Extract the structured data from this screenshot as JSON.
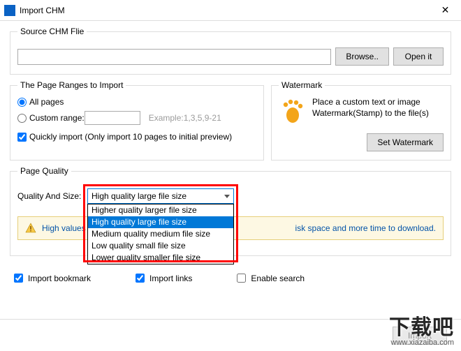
{
  "window": {
    "title": "Import CHM",
    "close": "✕"
  },
  "source": {
    "legend": "Source CHM Flie",
    "value": "",
    "browse": "Browse..",
    "open": "Open it"
  },
  "ranges": {
    "legend": "The Page Ranges to Import",
    "all_label": "All pages",
    "custom_label": "Custom range:",
    "custom_value": "",
    "example": "Example:1,3,5,9-21",
    "quick_label": "Quickly import (Only import 10 pages to  initial  preview)"
  },
  "watermark": {
    "legend": "Watermark",
    "text": "Place a custom text or image Watermark(Stamp) to the file(s)",
    "set_btn": "Set Watermark"
  },
  "quality": {
    "legend": "Page Quality",
    "label": "Quality And Size:",
    "selected": "High quality large file size",
    "options": [
      "Higher quality larger file size",
      "High quality large file size",
      "Medium quality medium file size",
      "Low quality small file size",
      "Lower quality smaller file size"
    ],
    "notice_pre": "High values p",
    "notice_post": "isk space and more time to download."
  },
  "checks": {
    "bookmark": "Import bookmark",
    "links": "Import links",
    "search": "Enable search"
  },
  "footer": {
    "import": "Import"
  },
  "overlay": {
    "logo": "下载吧",
    "url": "www.xiazaiba.com"
  }
}
